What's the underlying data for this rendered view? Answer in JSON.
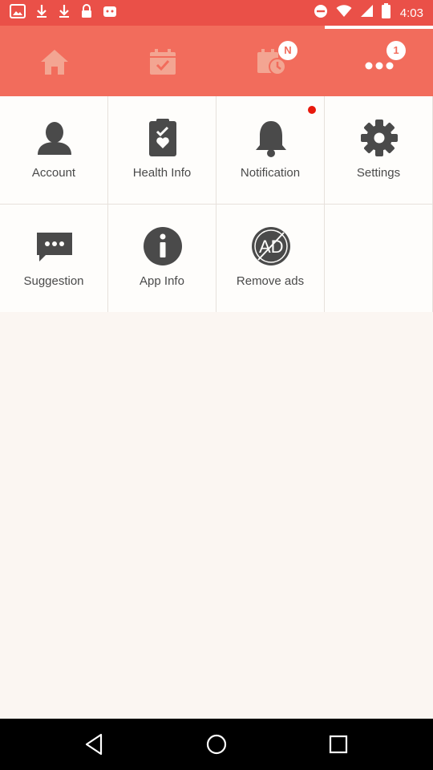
{
  "status_bar": {
    "time": "4:03",
    "left_icons": [
      "image-icon",
      "download-icon",
      "download-icon",
      "lock-icon",
      "app-icon"
    ],
    "right_icons": [
      "do-not-disturb-icon",
      "wifi-icon",
      "signal-icon",
      "battery-icon"
    ]
  },
  "tabs": [
    {
      "icon": "home-icon",
      "active": false
    },
    {
      "icon": "calendar-icon",
      "active": false
    },
    {
      "icon": "schedule-icon",
      "badge": "N",
      "active": false
    },
    {
      "icon": "more-icon",
      "badge": "1",
      "active": true
    }
  ],
  "grid": [
    {
      "label": "Account",
      "icon": "account-icon"
    },
    {
      "label": "Health Info",
      "icon": "health-info-icon"
    },
    {
      "label": "Notification",
      "icon": "bell-icon"
    },
    {
      "label": "Settings",
      "icon": "gear-icon"
    },
    {
      "label": "Suggestion",
      "icon": "chat-icon"
    },
    {
      "label": "App Info",
      "icon": "info-icon"
    },
    {
      "label": "Remove ads",
      "icon": "ad-icon"
    }
  ],
  "nav_bar": {
    "buttons": [
      "back-icon",
      "home-circle-icon",
      "recents-icon"
    ]
  },
  "colors": {
    "status_bar": "#ea5048",
    "tab_bar": "#f26c5c",
    "tab_icon": "#f3a592",
    "grid_icon": "#4a4a4a",
    "background": "#fbf6f2",
    "notification_dot": "#e8190c"
  }
}
